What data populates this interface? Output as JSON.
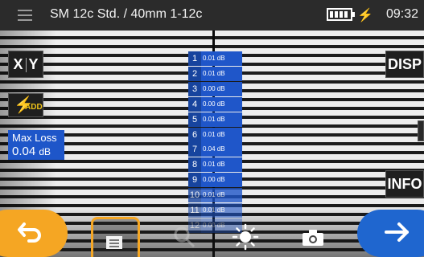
{
  "statusbar": {
    "title": "SM 12c Std. / 40mm 1-12c",
    "time": "09:32"
  },
  "left_panel": {
    "xy_left": "X",
    "xy_right": "Y",
    "add_label": "ADD",
    "max_loss_label": "Max Loss",
    "max_loss_value": "0.04",
    "max_loss_unit": "dB"
  },
  "right_panel": {
    "disp_label": "DISP",
    "info_label": "INFO"
  },
  "loss_table": {
    "rows": [
      {
        "num": "1",
        "value": "0.01 dB"
      },
      {
        "num": "2",
        "value": "0.01 dB"
      },
      {
        "num": "3",
        "value": "0.00 dB"
      },
      {
        "num": "4",
        "value": "0.00 dB"
      },
      {
        "num": "5",
        "value": "0.01 dB"
      },
      {
        "num": "6",
        "value": "0.01 dB"
      },
      {
        "num": "7",
        "value": "0.04 dB"
      },
      {
        "num": "8",
        "value": "0.01 dB"
      },
      {
        "num": "9",
        "value": "0.00 dB"
      },
      {
        "num": "10",
        "value": "0.01 dB"
      },
      {
        "num": "11",
        "value": "0.01 dB"
      },
      {
        "num": "12",
        "value": "0.00 dB"
      }
    ]
  },
  "icons": {
    "menu": "menu-icon",
    "battery": "battery-icon",
    "charge": "lightning-icon",
    "back": "back-arrow-icon",
    "list": "list-icon",
    "zoom": "magnifier-icon",
    "brightness": "brightness-icon",
    "camera": "camera-icon",
    "next": "right-arrow-icon"
  },
  "colors": {
    "accent_orange": "#f5a623",
    "accent_blue": "#1f66cf",
    "table_blue": "#1f56c9"
  }
}
